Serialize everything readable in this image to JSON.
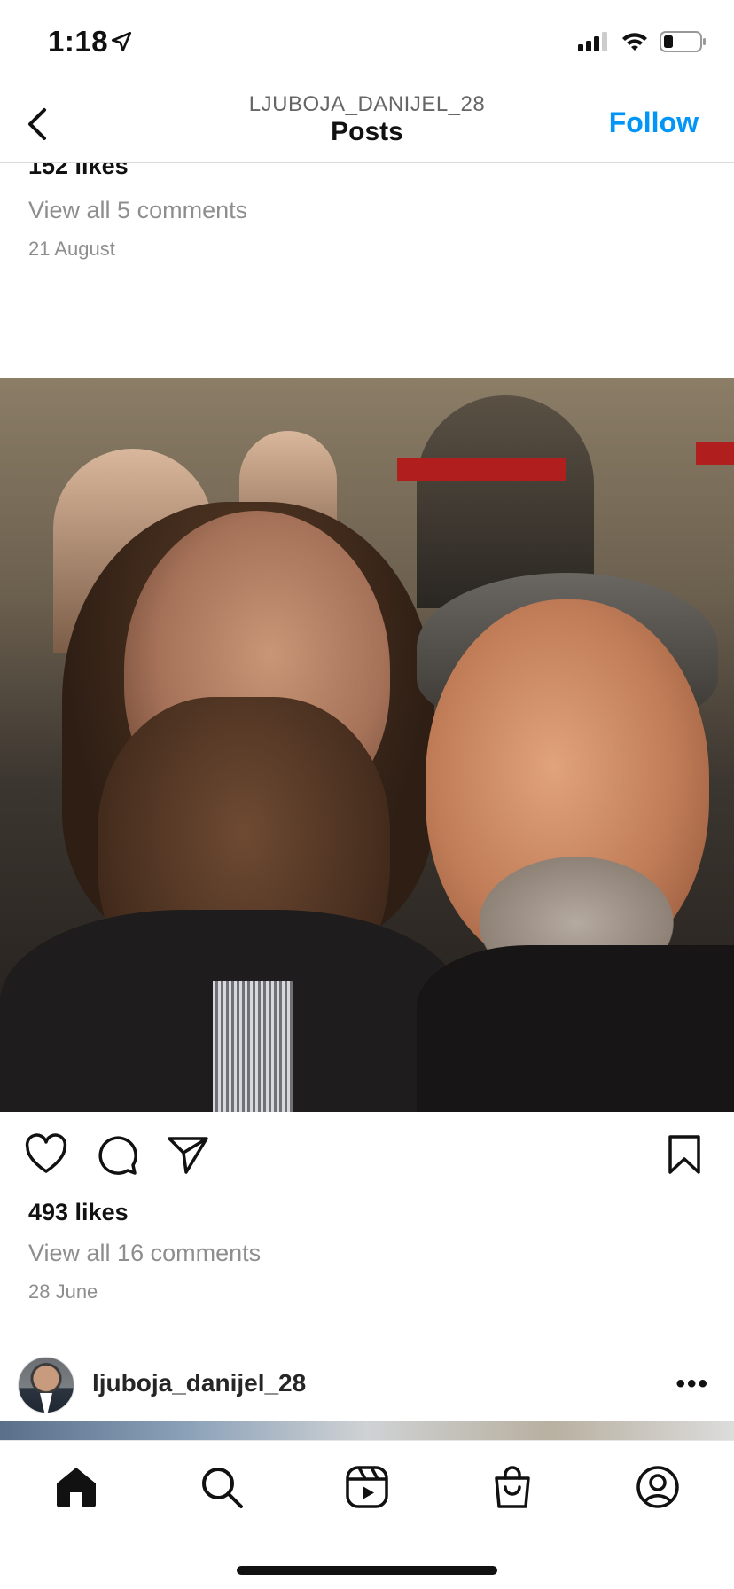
{
  "status_bar": {
    "time": "1:18",
    "icons": [
      "location-arrow-icon",
      "signal-bars-icon",
      "wifi-icon",
      "battery-icon"
    ]
  },
  "header": {
    "username": "LJUBOJA_DANIJEL_28",
    "title": "Posts",
    "follow_label": "Follow",
    "accent_color": "#0095f6"
  },
  "previous_post": {
    "likes": "152 likes",
    "comments_link": "View all 5 comments",
    "date": "21 August"
  },
  "post": {
    "username": "ljuboja_danijel_28",
    "more_label": "•••",
    "likes": "493 likes",
    "comments_link": "View all 16 comments",
    "date": "28 June",
    "action_icons": [
      "heart-icon",
      "comment-icon",
      "share-icon",
      "bookmark-icon"
    ]
  },
  "next_post": {
    "username": "ljuboja_danijel_28",
    "more_label": "•••"
  },
  "tab_bar": {
    "tabs": [
      "home-icon",
      "search-icon",
      "reels-icon",
      "shop-icon",
      "profile-icon"
    ],
    "active": "home-icon"
  }
}
